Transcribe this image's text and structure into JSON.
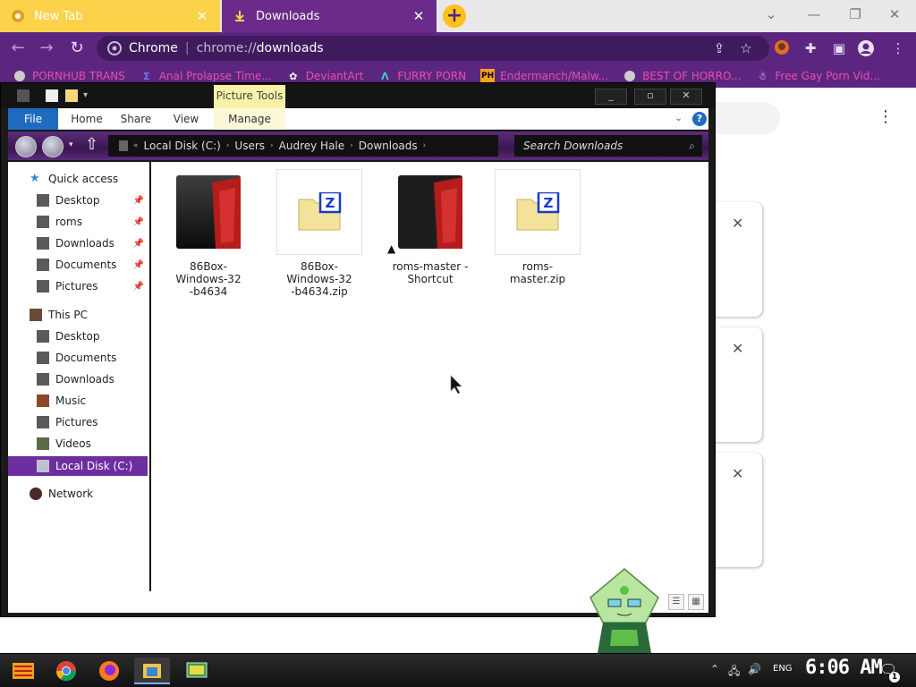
{
  "browser": {
    "tabs": [
      {
        "label": "New Tab",
        "active": false
      },
      {
        "label": "Downloads",
        "active": true
      }
    ],
    "address": {
      "scheme": "chrome://",
      "path": "downloads",
      "browser_label": "Chrome"
    },
    "bookmarks": [
      {
        "label": "PORNHUB TRANS",
        "icon": "globe-icon"
      },
      {
        "label": "Anal Prolapse Time...",
        "icon": "tumblr-icon"
      },
      {
        "label": "DeviantArt",
        "icon": "deviantart-icon"
      },
      {
        "label": "FURRY PORN",
        "icon": "furaffinity-icon"
      },
      {
        "label": "Endermanch/Malw...",
        "icon": "pornhub-icon"
      },
      {
        "label": "BEST OF HORRO...",
        "icon": "globe-icon"
      },
      {
        "label": "Free Gay Porn Vid...",
        "icon": "chef-icon"
      }
    ]
  },
  "explorer": {
    "title": "Downloads",
    "contextual_tab_group": "Picture Tools",
    "ribbon_tabs": [
      "File",
      "Home",
      "Share",
      "View",
      "Manage"
    ],
    "breadcrumb": [
      "Local Disk (C:)",
      "Users",
      "Audrey Hale",
      "Downloads"
    ],
    "search_placeholder": "Search Downloads",
    "nav": {
      "quick_access": {
        "label": "Quick access",
        "items": [
          "Desktop",
          "roms",
          "Downloads",
          "Documents",
          "Pictures"
        ]
      },
      "this_pc": {
        "label": "This PC",
        "items": [
          "Desktop",
          "Documents",
          "Downloads",
          "Music",
          "Pictures",
          "Videos",
          "Local Disk (C:)"
        ]
      },
      "network": {
        "label": "Network"
      }
    },
    "files": [
      {
        "name": "86Box-Windows-32-b4634",
        "name_lines": [
          "86Box-Windows-32",
          "-b4634"
        ],
        "type": "folder"
      },
      {
        "name": "86Box-Windows-32-b4634.zip",
        "name_lines": [
          "86Box-Windows-32",
          "-b4634.zip"
        ],
        "type": "zip"
      },
      {
        "name": "roms-master - Shortcut",
        "name_lines": [
          "roms-master -",
          "Shortcut"
        ],
        "type": "shortcut"
      },
      {
        "name": "roms-master.zip",
        "name_lines": [
          "roms-master.zip"
        ],
        "type": "zip"
      }
    ]
  },
  "taskbar": {
    "apps": [
      "start-icon",
      "chrome-icon",
      "firefox-icon",
      "file-explorer-icon",
      "monitor-app-icon"
    ],
    "language": "ENG",
    "clock": "6:06 AM",
    "notification_count": "1"
  },
  "colors": {
    "accent_purple": "#5c2680",
    "tab_yellow": "#fcd24a",
    "selected_nav": "#6d2fa0",
    "file_tab_blue": "#1f6bc0"
  }
}
